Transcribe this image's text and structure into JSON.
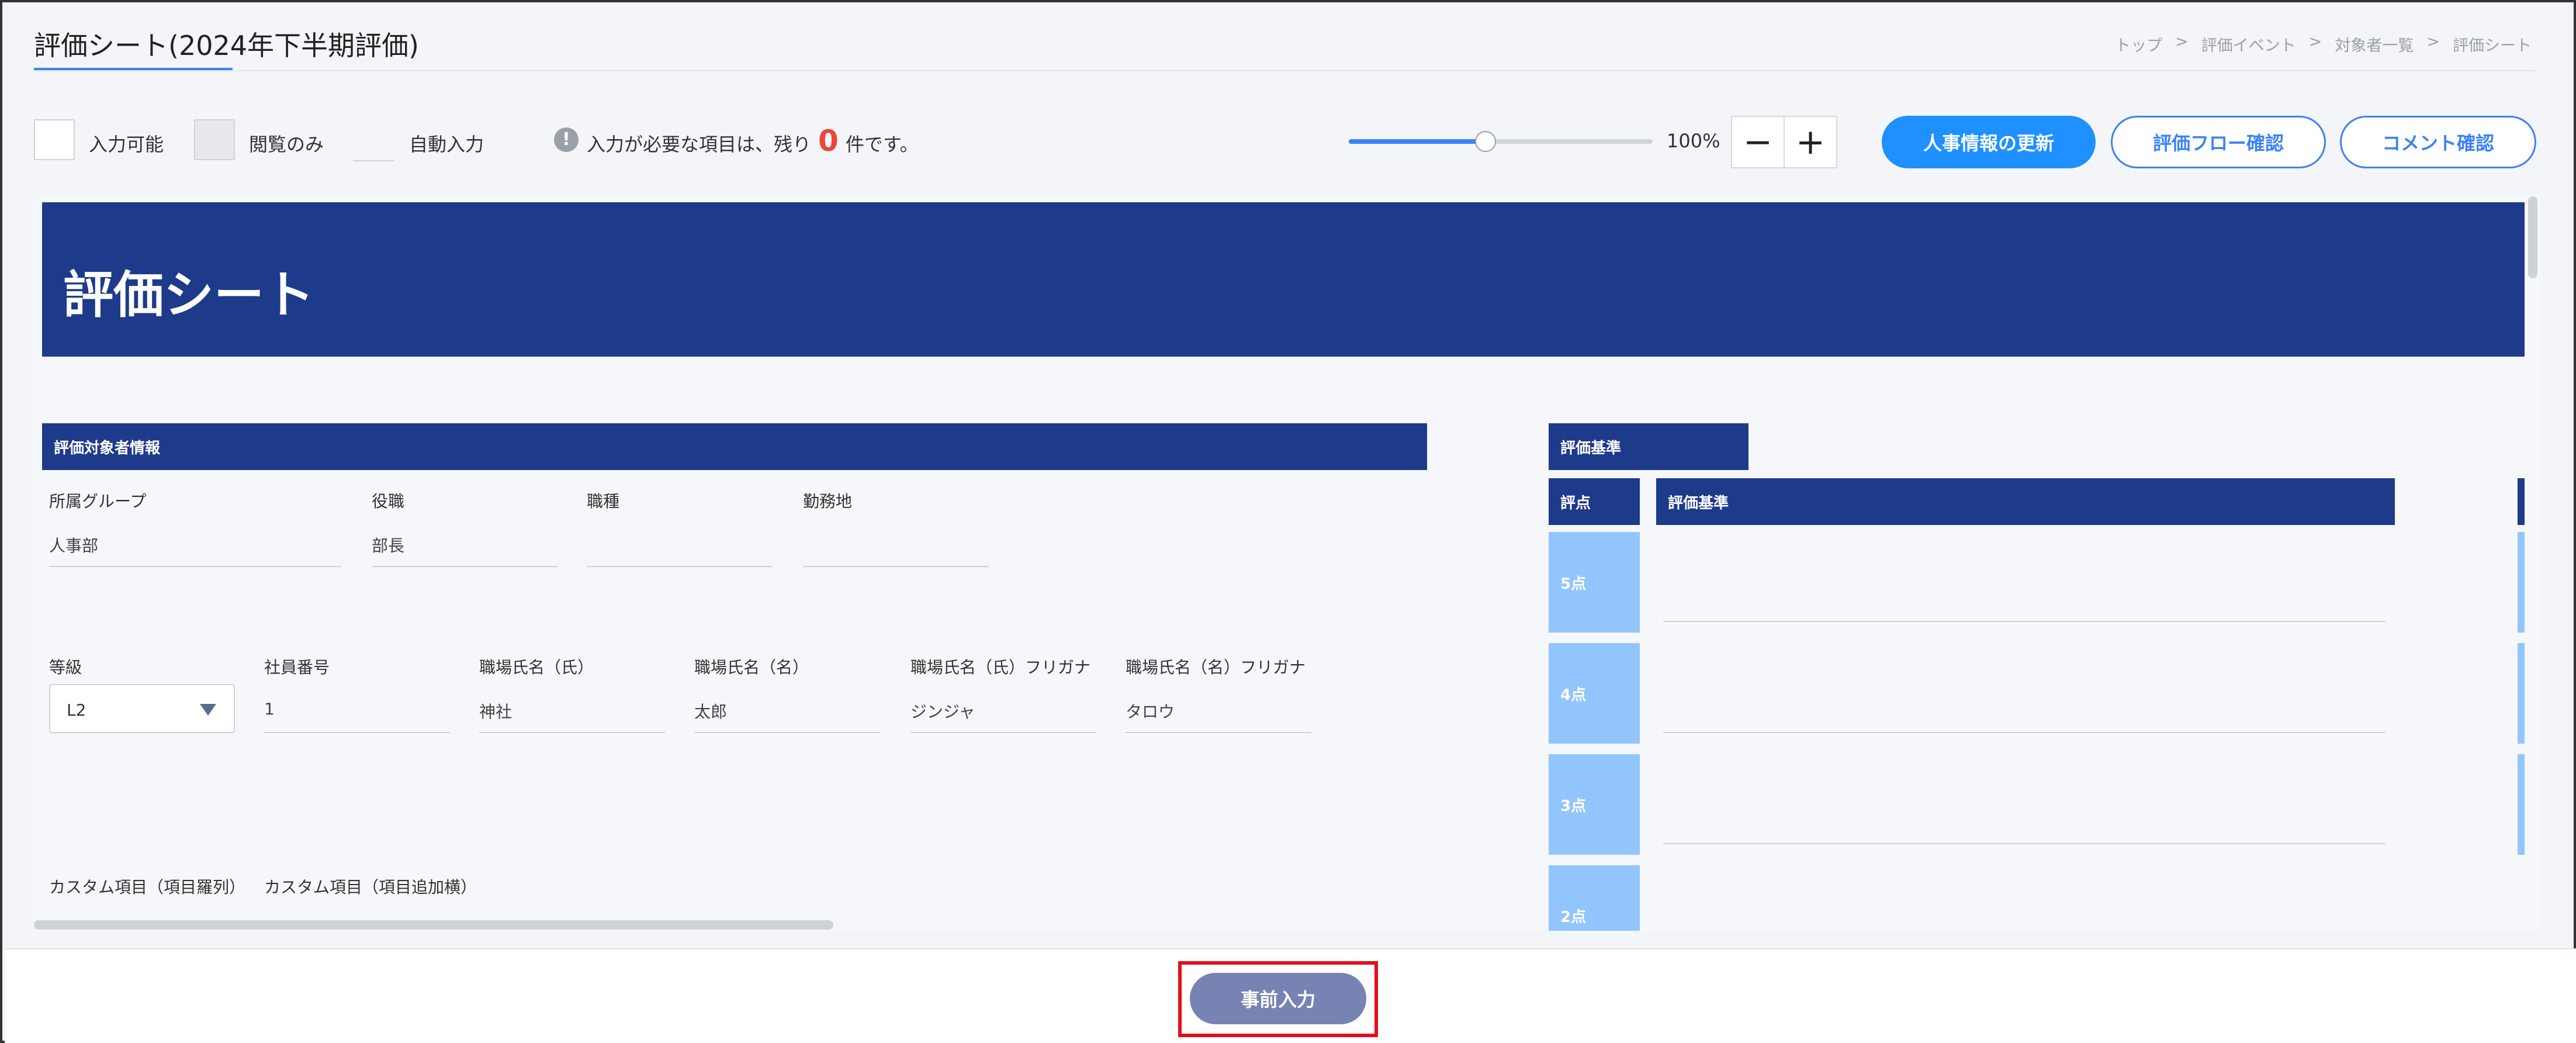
{
  "header": {
    "title": "評価シート(2024年下半期評価)",
    "breadcrumb": [
      "トップ",
      "評価イベント",
      "対象者一覧",
      "評価シート"
    ],
    "breadcrumb_sep": ">"
  },
  "legend": {
    "editable": "入力可能",
    "readonly": "閲覧のみ",
    "auto": "自動入力"
  },
  "notice": {
    "prefix": "入力が必要な項目は、残り",
    "count": "0",
    "suffix": "件です。"
  },
  "zoom": {
    "value": "100%",
    "level": 0.45,
    "minus": "−",
    "plus": "+"
  },
  "actions": {
    "update_hr": "人事情報の更新",
    "flow_check": "評価フロー確認",
    "comment_check": "コメント確認"
  },
  "sheet": {
    "banner_title": "評価シート",
    "subject_section": "評価対象者情報",
    "criteria_section": "評価基準",
    "fields_row1": [
      {
        "label": "所属グループ",
        "value": "人事部"
      },
      {
        "label": "役職",
        "value": "部長"
      },
      {
        "label": "職種",
        "value": ""
      },
      {
        "label": "勤務地",
        "value": ""
      }
    ],
    "grade": {
      "label": "等級",
      "value": "L2"
    },
    "fields_row2": [
      {
        "label": "社員番号",
        "value": "1"
      },
      {
        "label": "職場氏名（氏）",
        "value": "神社"
      },
      {
        "label": "職場氏名（名）",
        "value": "太郎"
      },
      {
        "label": "職場氏名（氏）フリガナ",
        "value": "ジンジャ"
      },
      {
        "label": "職場氏名（名）フリガナ",
        "value": "タロウ"
      }
    ],
    "custom_labels": [
      "カスタム項目（項目羅列）",
      "カスタム項目（項目追加横）"
    ],
    "criteria_header": {
      "score": "評点",
      "criteria": "評価基準"
    },
    "scores": [
      "5点",
      "4点",
      "3点",
      "2点"
    ]
  },
  "footer": {
    "pre_input": "事前入力"
  },
  "colors": {
    "accent": "#3b82f6",
    "banner": "#1e3a8a",
    "score_cell": "#93c5fd",
    "notice_count": "#f0443a",
    "highlight": "#e0101a"
  }
}
